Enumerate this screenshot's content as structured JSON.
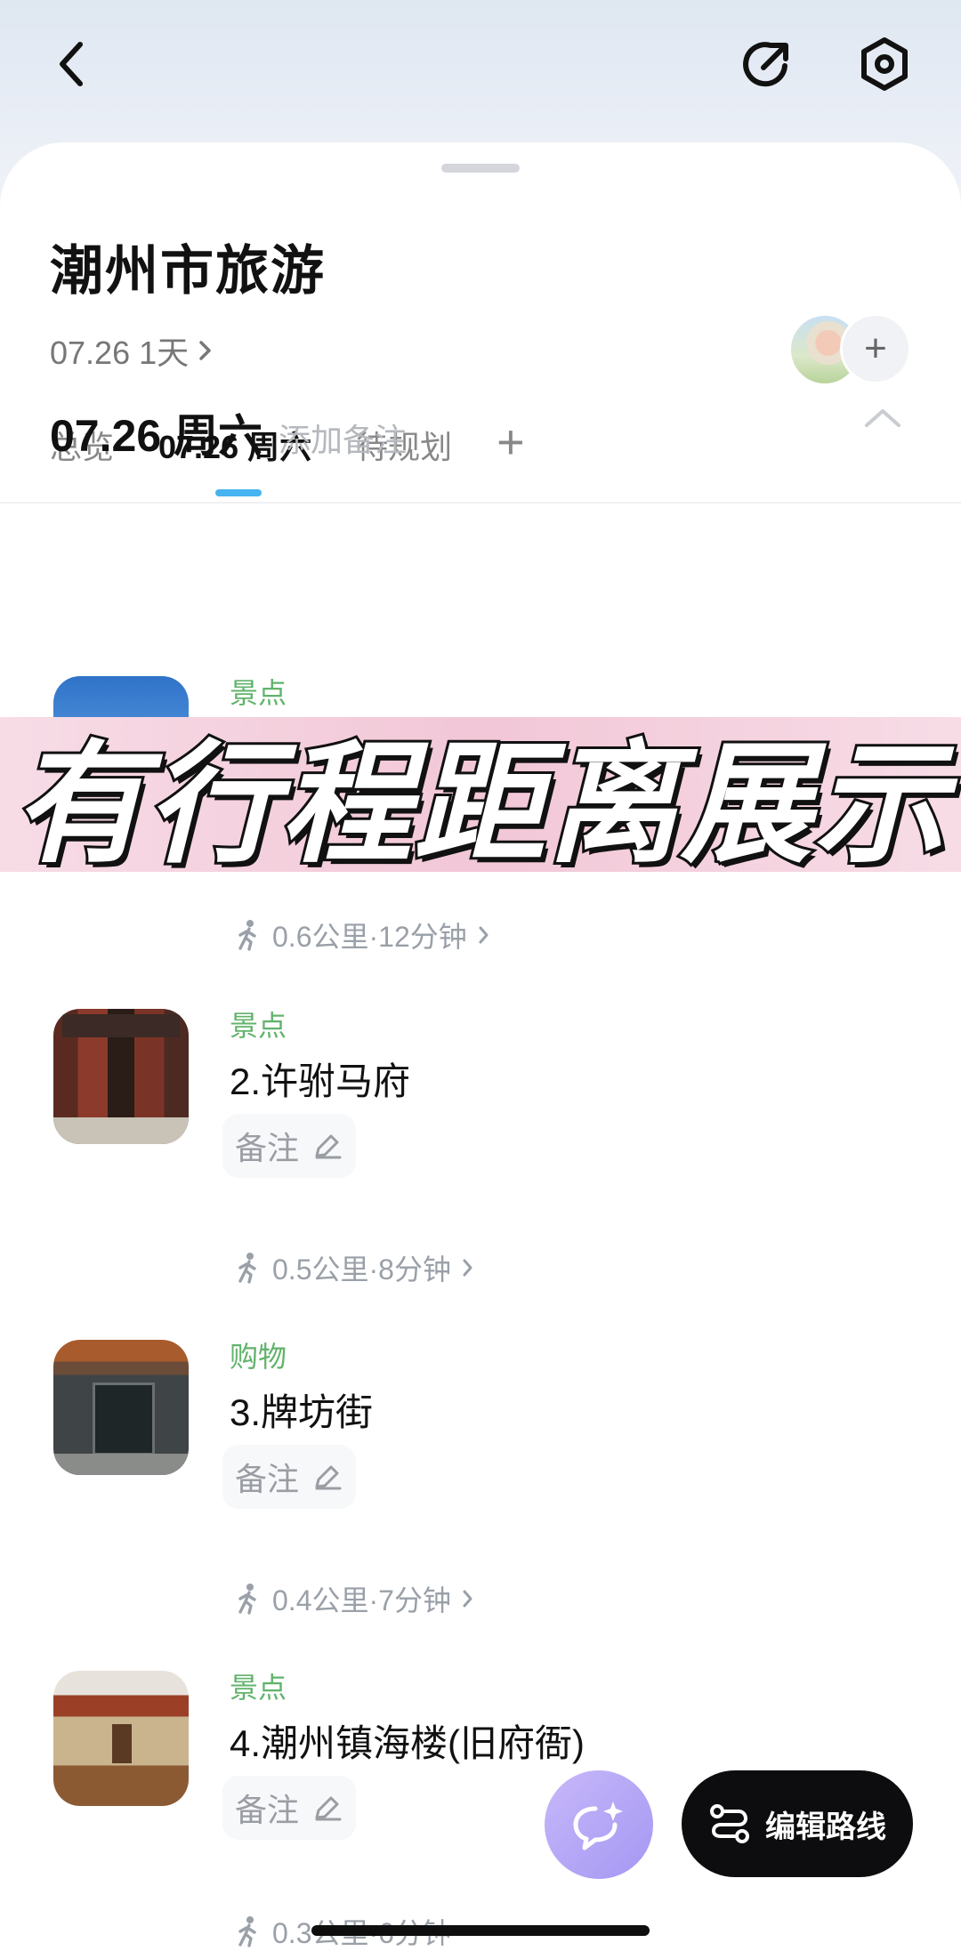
{
  "header": {
    "back_icon": "chevron-left-icon",
    "share_icon": "share-icon",
    "settings_icon": "settings-hex-icon"
  },
  "trip": {
    "title": "潮州市旅游",
    "date_range": "07.26 1天",
    "add_member_label": "+"
  },
  "tabs": [
    {
      "label": "总览",
      "active": false
    },
    {
      "label": "07.26 周六",
      "active": true
    },
    {
      "label": "待规划",
      "active": false
    }
  ],
  "tab_add_label": "+",
  "day": {
    "title": "07.26 周六",
    "note_placeholder": "添加备注"
  },
  "banner": {
    "text": "有行程距离展示"
  },
  "items": [
    {
      "category": "景点",
      "name": "",
      "note_label": "备注"
    },
    {
      "category": "景点",
      "name": "2.许驸马府",
      "note_label": "备注"
    },
    {
      "category": "购物",
      "name": "3.牌坊街",
      "note_label": "备注"
    },
    {
      "category": "景点",
      "name": "4.潮州镇海楼(旧府衙)",
      "note_label": "备注"
    }
  ],
  "routes": [
    {
      "text": "0.6公里·12分钟"
    },
    {
      "text": "0.5公里·8分钟"
    },
    {
      "text": "0.4公里·7分钟"
    },
    {
      "text": "0.3公里·6分钟"
    }
  ],
  "actions": {
    "edit_route_label": "编辑路线"
  },
  "colors": {
    "category": "#62b36c",
    "tab_indicator": "#45b4f0",
    "fab": "#b0a3f5",
    "banner": "#f3cddd"
  }
}
